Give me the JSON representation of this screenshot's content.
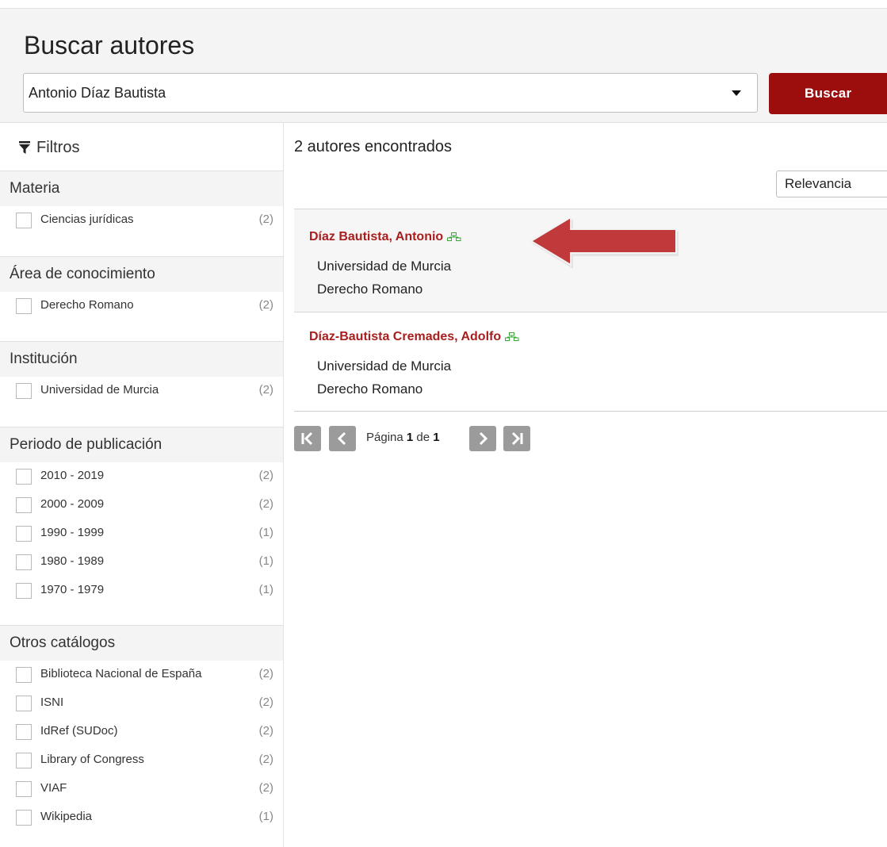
{
  "header": {
    "title": "Buscar autores",
    "search_value": "Antonio Díaz Bautista",
    "search_button": "Buscar"
  },
  "sidebar": {
    "title": "Filtros",
    "sections": [
      {
        "title": "Materia",
        "items": [
          {
            "label": "Ciencias jurídicas",
            "count": "(2)"
          }
        ]
      },
      {
        "title": "Área de conocimiento",
        "items": [
          {
            "label": "Derecho Romano",
            "count": "(2)"
          }
        ]
      },
      {
        "title": "Institución",
        "items": [
          {
            "label": "Universidad de Murcia",
            "count": "(2)"
          }
        ]
      },
      {
        "title": "Periodo de publicación",
        "items": [
          {
            "label": "2010 - 2019",
            "count": "(2)"
          },
          {
            "label": "2000 - 2009",
            "count": "(2)"
          },
          {
            "label": "1990 - 1999",
            "count": "(1)"
          },
          {
            "label": "1980 - 1989",
            "count": "(1)"
          },
          {
            "label": "1970 - 1979",
            "count": "(1)"
          }
        ]
      },
      {
        "title": "Otros catálogos",
        "items": [
          {
            "label": "Biblioteca Nacional de España",
            "count": "(2)"
          },
          {
            "label": "ISNI",
            "count": "(2)"
          },
          {
            "label": "IdRef (SUDoc)",
            "count": "(2)"
          },
          {
            "label": "Library of Congress",
            "count": "(2)"
          },
          {
            "label": "VIAF",
            "count": "(2)"
          },
          {
            "label": "Wikipedia",
            "count": "(1)"
          }
        ]
      }
    ]
  },
  "results": {
    "count_text": "2 autores encontrados",
    "sort_value": "Relevancia",
    "items": [
      {
        "name": "Díaz Bautista, Antonio",
        "institution": "Universidad de Murcia",
        "area": "Derecho Romano"
      },
      {
        "name": "Díaz-Bautista Cremades, Adolfo",
        "institution": "Universidad de Murcia",
        "area": "Derecho Romano"
      }
    ]
  },
  "pagination": {
    "page_label": "Página",
    "current": "1",
    "of_label": "de",
    "total": "1"
  },
  "colors": {
    "brand": "#9c0d0d",
    "name_link": "#a81e1e",
    "annotation_arrow": "#c0393b"
  }
}
